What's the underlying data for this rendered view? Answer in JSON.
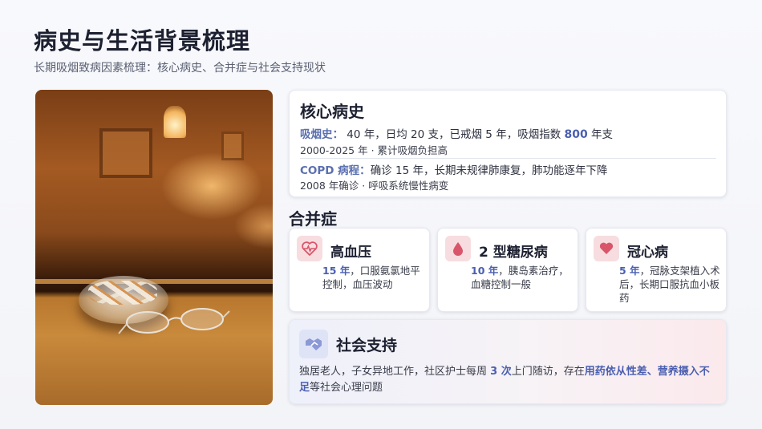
{
  "header": {
    "title": "病史与生活背景梳理",
    "subtitle": "长期吸烟致病因素梳理：核心病史、合并症与社会支持现状"
  },
  "core": {
    "heading": "核心病史",
    "smoking_label": "吸烟史：",
    "smoking_text": " 40 年，日均 20 支，已戒烟 5 年，吸烟指数 ",
    "smoking_index": "800",
    "smoking_unit": " 年支",
    "smoking_note": "2000-2025 年 · 累计吸烟负担高",
    "copd_label": "COPD 病程：",
    "copd_text": "确诊 15 年，长期未规律肺康复，肺功能逐年下降",
    "copd_note": "2008 年确诊 · 呼吸系统慢性病变"
  },
  "comorbidity": {
    "heading": "合并症",
    "items": [
      {
        "title": "高血压",
        "years": "15 年",
        "desc": "，口服氨氯地平控制，血压波动",
        "icon": "heartbeat-icon"
      },
      {
        "title": "2 型糖尿病",
        "years": "10 年",
        "desc": "，胰岛素治疗，血糖控制一般",
        "icon": "drop-icon"
      },
      {
        "title": "冠心病",
        "years": "5 年",
        "desc": "，冠脉支架植入术后，长期口服抗血小板药",
        "icon": "heart-icon"
      }
    ]
  },
  "social": {
    "heading": "社会支持",
    "icon": "handshake-icon",
    "text_a": "独居老人，子女异地工作，社区护士每周 ",
    "visits": "3 次",
    "text_b": "上门随访，存在",
    "highlight": "用药依从性差、营养摄入不足",
    "text_c": "等社会心理问题"
  },
  "colors": {
    "accent": "#4a5fb0",
    "icon_bg_red": "#f7dde0",
    "icon_red": "#d9566a"
  }
}
